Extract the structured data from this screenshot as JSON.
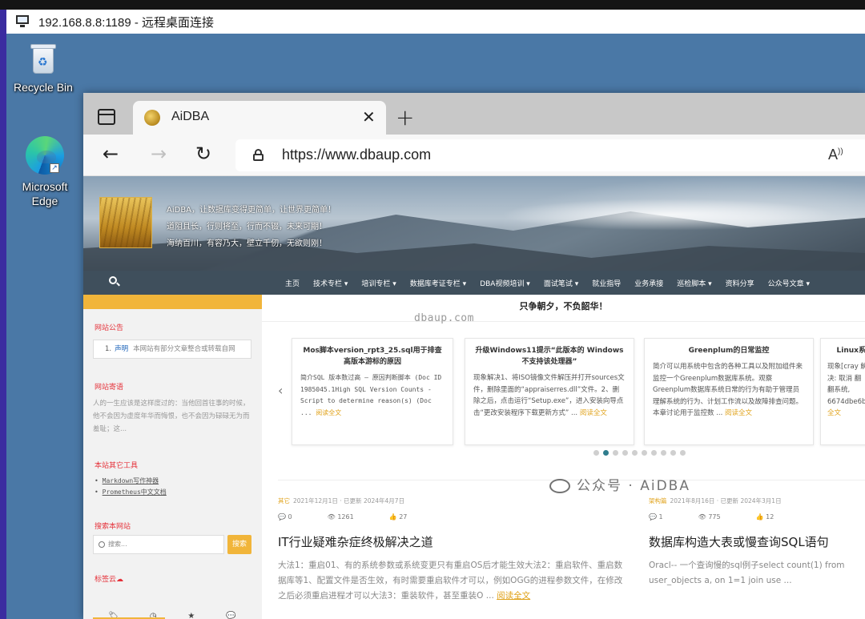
{
  "rdp": {
    "title": "192.168.8.8:1189 - 远程桌面连接"
  },
  "desktop": {
    "icons": [
      {
        "label": "Recycle Bin",
        "icon": "recycle-bin-icon"
      },
      {
        "label_line1": "Microsoft",
        "label_line2": "Edge",
        "icon": "edge-icon"
      }
    ]
  },
  "browser": {
    "tab_title": "AiDBA",
    "url": "https://www.dbaup.com"
  },
  "site": {
    "slogans": [
      "AiDBA，让数据库变得更简单，让世界更简单！",
      "道阻且长，行则将至，行而不辍，未来可期！",
      "海纳百川，有容乃大，壁立千仞，无欲则刚！"
    ],
    "nav": [
      "主页",
      "技术专栏 ▾",
      "培训专栏 ▾",
      "数据库考证专栏 ▾",
      "DBA视频培训 ▾",
      "面试笔试 ▾",
      "就业指导",
      "业务承接",
      "巡检脚本 ▾",
      "资料分享",
      "公众号文章 ▾"
    ],
    "sidebar": {
      "notice_title": "网站公告",
      "notice_num": "1.",
      "notice_tag": "声明",
      "notice_text": "本网站有部分文章整合或转载自网",
      "motto_title": "网站寄语",
      "motto_text": "人的一生应该是这样度过的：当他回首往事的时候，他不会因为虚度年华而悔恨，也不会因为碌碌无为而羞耻；这...",
      "tools_title": "本站其它工具",
      "tools": [
        "Markdown写作神器",
        "Prometheus中文文档"
      ],
      "search_title": "搜索本网站",
      "search_placeholder": "搜索...",
      "search_button": "搜索",
      "tagcloud_title": "标签云☁"
    },
    "main": {
      "motto": "只争朝夕，不负韶华！",
      "watermark": "dbaup.com",
      "cards": [
        {
          "title": "Mos脚本version_rpt3_25.sql用于排查高版本游标的原因",
          "body": "简介SQL 版本数过高 – 原因判断脚本 (Doc ID 1985045.1High SQL Version Counts - Script to determine reason(s) (Doc ...",
          "more": "阅读全文"
        },
        {
          "title": "升级Windows11提示“此版本的 Windows 不支持该处理器”",
          "body": "现象解决1、将ISO镜像文件解压并打开sources文件，删除里面的“appraiserres.dll”文件。2、删除之后，点击运行“Setup.exe”，进入安装向导点击“更改安装程序下载更新方式” ...",
          "more": "阅读全文"
        },
        {
          "title": "Greenplum的日常监控",
          "body": "简介可以用系统中包含的各种工具以及附加组件来监控一个Greenplum数据库系统。观察Greenplum数据库系统日常的行为有助于管理员理解系统的行为、计划工作流以及故障排查问题。 本章讨论用于监控数 ...",
          "more": "阅读全文"
        },
        {
          "title": "Linux系",
          "body": "现象[cray 解决: 取消 翻翻系统, 6674dbe6b",
          "more": "全文"
        }
      ],
      "posts": [
        {
          "cat": "其它",
          "meta": "2021年12月1日 · 已更新 2024年4月7日",
          "comments": "0",
          "views": "1261",
          "likes": "27",
          "title": "IT行业疑难杂症终极解决之道",
          "excerpt": "大法1：重启01、有的系统参数或系统变更只有重启OS后才能生效大法2：重启软件、重启数据库等1、配置文件是否生效，有时需要重启软件才可以，例如OGG的进程参数文件，在修改之后必须重启进程才可以大法3：重装软件，甚至重装O ...",
          "more": "阅读全文"
        },
        {
          "cat": "架构篇",
          "meta": "2021年8月16日 · 已更新 2024年3月1日",
          "comments": "1",
          "views": "775",
          "likes": "12",
          "title": "数据库构造大表或慢查询SQL语句",
          "excerpt": "Oracl-- 一个查询慢的sql例子select count(1) from user_objects a, on 1=1 join use ...",
          "more": ""
        }
      ]
    }
  },
  "overlay": {
    "wechat": "公众号 · AiDBA"
  }
}
